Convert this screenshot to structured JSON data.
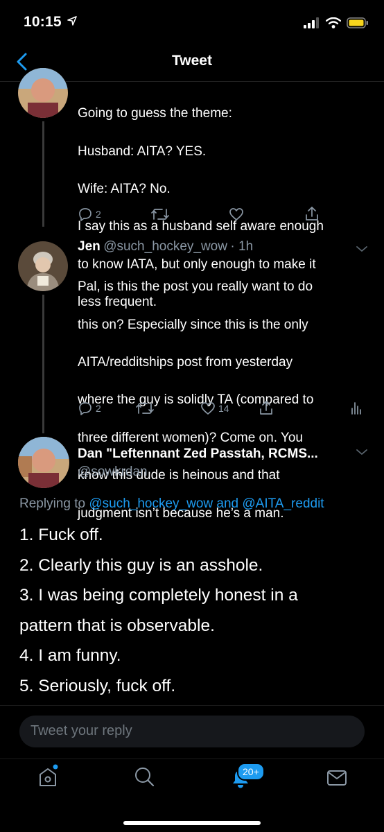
{
  "status_bar": {
    "time": "10:15"
  },
  "nav": {
    "title": "Tweet"
  },
  "tweet1": {
    "lines": [
      "Going to guess the theme:",
      "Husband: AITA? YES.",
      "Wife: AITA? No.",
      "I say this as a husband self aware enough",
      "to know IATA, but only enough to make it",
      "less frequent."
    ],
    "replies": "2"
  },
  "tweet2": {
    "name": "Jen",
    "handle": "@such_hockey_wow",
    "time": "· 1h",
    "lines": [
      "Pal, is this the post you really want to do",
      "this on? Especially since this is the only",
      "AITA/redditships post from yesterday",
      "where the guy is solidly TA (compared to",
      "three different women)? Come on. You",
      "know this dude is heinous and that",
      "judgment isn’t because he’s a man."
    ],
    "replies": "2",
    "likes": "14"
  },
  "main_tweet": {
    "name": "Dan \"Leftennant Zed Passtah, RCMS...",
    "handle": "@sowkrdan",
    "replying_prefix": "Replying to ",
    "replying_to_1": "@such_hockey_wow",
    "replying_and": " and ",
    "replying_to_2": "@AITA_reddit",
    "lines": [
      "1. Fuck off.",
      "2. Clearly this guy is an asshole.",
      "3. I was being completely honest in a",
      "pattern that is observable.",
      "4. I am funny.",
      "5. Seriously, fuck off."
    ]
  },
  "reply_box": {
    "placeholder": "Tweet your reply"
  },
  "tab_bar": {
    "notifications_badge": "20+"
  },
  "colors": {
    "accent": "#1d9bf0",
    "muted": "#8b98a5",
    "background": "#000000"
  },
  "icons": [
    "back-chevron-icon",
    "reply-icon",
    "retweet-icon",
    "like-icon",
    "share-icon",
    "analytics-icon",
    "home-icon",
    "search-icon",
    "notifications-icon",
    "messages-icon"
  ]
}
